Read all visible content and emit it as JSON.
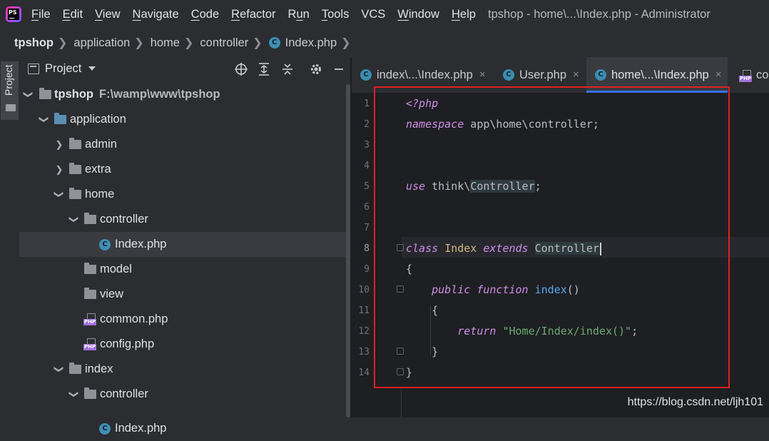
{
  "app": {
    "logo_text": "PS",
    "window_title": "tpshop - home\\...\\Index.php - Administrator"
  },
  "menu": [
    {
      "mnemonic": "F",
      "rest": "ile"
    },
    {
      "mnemonic": "E",
      "rest": "dit"
    },
    {
      "mnemonic": "V",
      "rest": "iew"
    },
    {
      "mnemonic": "N",
      "rest": "avigate"
    },
    {
      "mnemonic": "C",
      "rest": "ode"
    },
    {
      "mnemonic": "R",
      "rest": "efactor"
    },
    {
      "mnemonic": "R",
      "rest": "un",
      "split": true,
      "before": "R",
      "after": "n",
      "mid": "u"
    },
    {
      "mnemonic": "T",
      "rest": "ools"
    },
    {
      "mnemonic": "",
      "rest": "VCS"
    },
    {
      "mnemonic": "W",
      "rest": "indow"
    },
    {
      "mnemonic": "H",
      "rest": "elp"
    }
  ],
  "breadcrumb": [
    "tpshop",
    "application",
    "home",
    "controller",
    "Index.php"
  ],
  "tool_strip": {
    "label": "Project"
  },
  "project_panel": {
    "title": "Project",
    "icons": [
      "crosshair-icon",
      "expand-all-icon",
      "collapse-all-icon",
      "gear-icon",
      "minimize-icon"
    ]
  },
  "tree": [
    {
      "label": "tpshop",
      "sub": "F:\\wamp\\www\\tpshop",
      "level": 0,
      "expanded": true,
      "type": "folder"
    },
    {
      "label": "application",
      "level": 1,
      "expanded": true,
      "type": "folder-blue"
    },
    {
      "label": "admin",
      "level": 2,
      "expanded": false,
      "type": "folder"
    },
    {
      "label": "extra",
      "level": 2,
      "expanded": false,
      "type": "folder"
    },
    {
      "label": "home",
      "level": 2,
      "expanded": true,
      "type": "folder"
    },
    {
      "label": "controller",
      "level": 3,
      "expanded": true,
      "type": "folder"
    },
    {
      "label": "Index.php",
      "level": 4,
      "type": "class",
      "selected": true
    },
    {
      "label": "model",
      "level": 3,
      "type": "folder"
    },
    {
      "label": "view",
      "level": 3,
      "type": "folder"
    },
    {
      "label": "common.php",
      "level": 3,
      "type": "php"
    },
    {
      "label": "config.php",
      "level": 3,
      "type": "php"
    },
    {
      "label": "index",
      "level": 2,
      "expanded": true,
      "type": "folder"
    },
    {
      "label": "controller",
      "level": 3,
      "expanded": true,
      "type": "folder"
    },
    {
      "label": "Index.php",
      "level": 4,
      "type": "class"
    }
  ],
  "tabs": [
    {
      "label": "index\\...\\Index.php",
      "close": "×",
      "active": false
    },
    {
      "label": "User.php",
      "close": "×",
      "active": false
    },
    {
      "label": "home\\...\\Index.php",
      "close": "×",
      "active": true
    },
    {
      "label": "co",
      "active": false,
      "php_icon": true
    }
  ],
  "editor": {
    "line_numbers": [
      "1",
      "2",
      "3",
      "4",
      "5",
      "6",
      "7",
      "8",
      "9",
      "10",
      "11",
      "12",
      "13",
      "14"
    ],
    "current_line": 8,
    "code": {
      "l1": "<?php",
      "l2_kw": "namespace",
      "l2_rest": " app\\home\\controller;",
      "l5_kw": "use",
      "l5_a": " think\\",
      "l5_ref": "Controller",
      "l5_end": ";",
      "l8_kw": "class",
      "l8_cls": "Index",
      "l8_kw2": "extends",
      "l8_ref": "Controller",
      "l9": "{",
      "l10_kw": "public",
      "l10_kw2": "function",
      "l10_fn": "index",
      "l10_end": "()",
      "l11": "{",
      "l12_kw": "return",
      "l12_str": "\"Home/Index/index()\"",
      "l12_end": ";",
      "l13": "}",
      "l14": "}"
    }
  },
  "watermark": "https://blog.csdn.net/ljh101",
  "colors": {
    "keyword": "#cf8ee8",
    "class": "#d5b778",
    "function": "#56a8f5",
    "string": "#6aab73",
    "highlight_box": "#e02020",
    "active_tab_underline": "#3574f0"
  }
}
